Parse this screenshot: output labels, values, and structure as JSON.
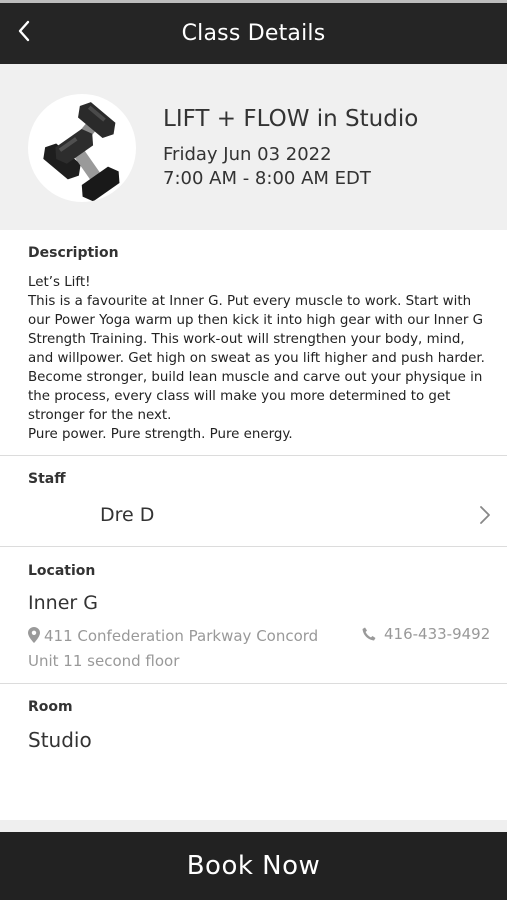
{
  "header": {
    "title": "Class Details"
  },
  "class": {
    "title": "LIFT + FLOW in Studio",
    "date": "Friday Jun 03 2022",
    "time": "7:00 AM - 8:00 AM EDT"
  },
  "description": {
    "label": "Description",
    "text": "Let’s Lift!\nThis is a favourite at Inner G. Put every muscle to work. Start with our Power Yoga warm up then kick it into high gear with our Inner G Strength Training. This work-out will strengthen your body, mind, and willpower. Get high on sweat as you lift higher and push harder. Become stronger, build lean muscle and carve out your physique in the process, every class will make you more determined to get stronger for the next.\nPure power. Pure strength. Pure energy."
  },
  "staff": {
    "label": "Staff",
    "name": "Dre D"
  },
  "location": {
    "label": "Location",
    "name": "Inner G",
    "address_line1": "411 Confederation Parkway Concord",
    "address_line2": "Unit 11 second floor",
    "phone": "416-433-9492"
  },
  "room": {
    "label": "Room",
    "name": "Studio"
  },
  "actions": {
    "book_label": "Book Now"
  },
  "icons": {
    "back": "chevron-left-icon",
    "staff_chevron": "chevron-right-icon",
    "location": "map-pin-icon",
    "phone": "phone-icon",
    "class_image": "dumbbells-icon"
  },
  "colors": {
    "header_bg": "#252525",
    "hero_bg": "#f0f0f0",
    "book_button_bg": "#222222",
    "muted_text": "#999999"
  }
}
